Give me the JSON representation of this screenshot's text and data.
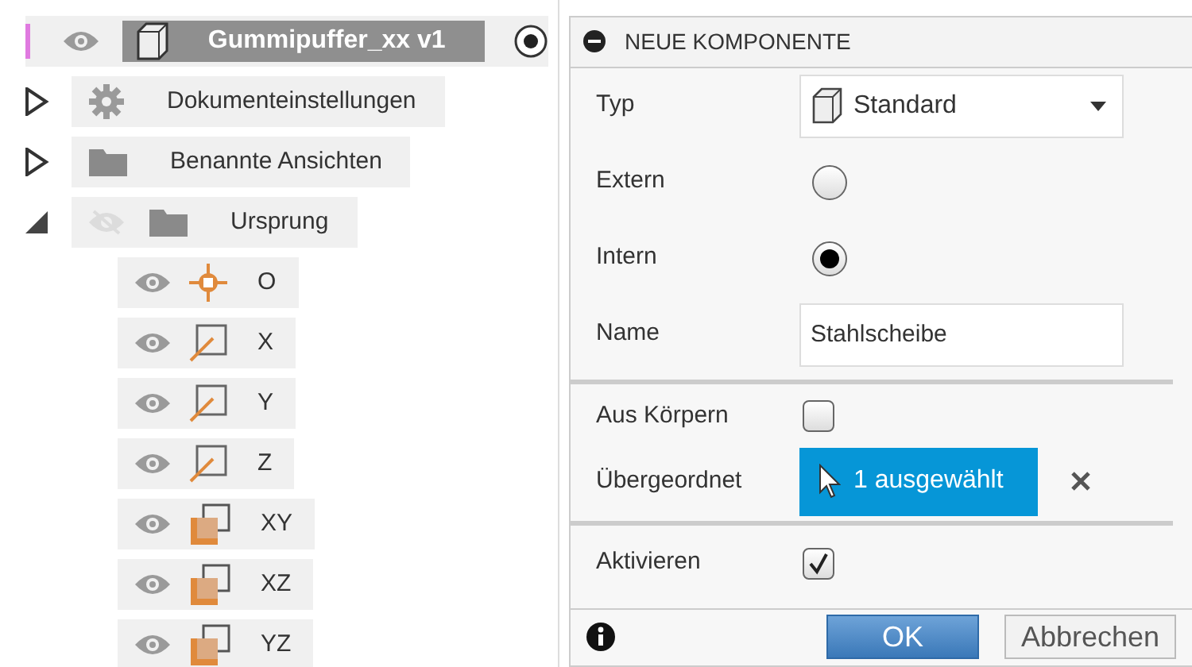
{
  "browser": {
    "root": {
      "label": "Gummipuffer_xx v1",
      "visible": true,
      "active": true
    },
    "items": [
      {
        "label": "Dokumenteinstellungen",
        "kind": "settings",
        "expanded": false
      },
      {
        "label": "Benannte Ansichten",
        "kind": "folder",
        "expanded": false
      },
      {
        "label": "Ursprung",
        "kind": "folder",
        "expanded": true,
        "visible": false,
        "children": [
          {
            "label": "O",
            "kind": "point",
            "visible": true
          },
          {
            "label": "X",
            "kind": "axis",
            "visible": true
          },
          {
            "label": "Y",
            "kind": "axis",
            "visible": true
          },
          {
            "label": "Z",
            "kind": "axis",
            "visible": true
          },
          {
            "label": "XY",
            "kind": "plane",
            "visible": true
          },
          {
            "label": "XZ",
            "kind": "plane",
            "visible": true
          },
          {
            "label": "YZ",
            "kind": "plane",
            "visible": true
          }
        ]
      }
    ]
  },
  "dialog": {
    "title": "NEUE KOMPONENTE",
    "sections": [
      [
        {
          "kind": "select",
          "label": "Typ",
          "value": "Standard"
        },
        {
          "kind": "radio",
          "label": "Extern",
          "selected": false
        },
        {
          "kind": "radio",
          "label": "Intern",
          "selected": true
        },
        {
          "kind": "text",
          "label": "Name",
          "value": "Stahlscheibe"
        }
      ],
      [
        {
          "kind": "checkbox",
          "label": "Aus Körpern",
          "checked": false
        },
        {
          "kind": "selection",
          "label": "Übergeordnet",
          "value": "1 ausgewählt"
        }
      ],
      [
        {
          "kind": "checkbox",
          "label": "Aktivieren",
          "checked": true
        }
      ]
    ],
    "buttons": [
      {
        "label": "OK",
        "kind": "primary"
      },
      {
        "label": "Abbrechen",
        "kind": "secondary"
      }
    ]
  }
}
